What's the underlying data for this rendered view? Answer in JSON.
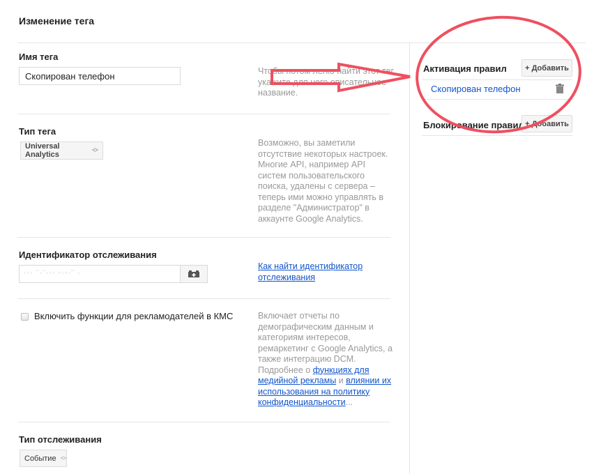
{
  "page": {
    "title": "Изменение тега"
  },
  "tag_name": {
    "label": "Имя тега",
    "value": "Скопирован телефон",
    "help": "Чтобы потом легко найти этот тег, укажите для него описательное название."
  },
  "tag_type": {
    "label": "Тип тега",
    "selected": "Universal Analytics",
    "help": "Возможно, вы заметили отсутствие некоторых настроек. Многие API, например API систем пользовательского поиска, удалены с сервера – теперь ими можно управлять в разделе \"Администратор\" в аккаунте Google Analytics."
  },
  "tracking_id": {
    "label": "Идентификатор отслеживания",
    "value": "UA-XXXXXXXX-1",
    "macro_icon": "variable-brick-icon",
    "help_link": "Как найти идентификатор отслеживания"
  },
  "display_features": {
    "checkbox_label": "Включить функции для рекламодателей в КМС",
    "checked": false,
    "help_text_1": "Включает отчеты по демографическим данным и категориям интересов, ремаркетинг с Google Analytics, а также интеграцию DCM. Подробнее о ",
    "help_link_1": "функциях для медийной рекламы",
    "help_text_2": " и ",
    "help_link_2": "влиянии их использования на политику конфиденциальности",
    "help_text_3": "..."
  },
  "track_type": {
    "label": "Тип отслеживания",
    "selected": "Событие"
  },
  "rules": {
    "firing": {
      "title": "Активация правил",
      "add_label": "+ Добавить",
      "items": [
        {
          "name": "Скопирован телефон",
          "icon": "trash-icon"
        }
      ]
    },
    "blocking": {
      "title": "Блокирование правил",
      "add_label": "+ Добавить"
    }
  },
  "annotations": {
    "color": "#ee5060",
    "shapes": [
      "arrow",
      "ellipse"
    ]
  }
}
